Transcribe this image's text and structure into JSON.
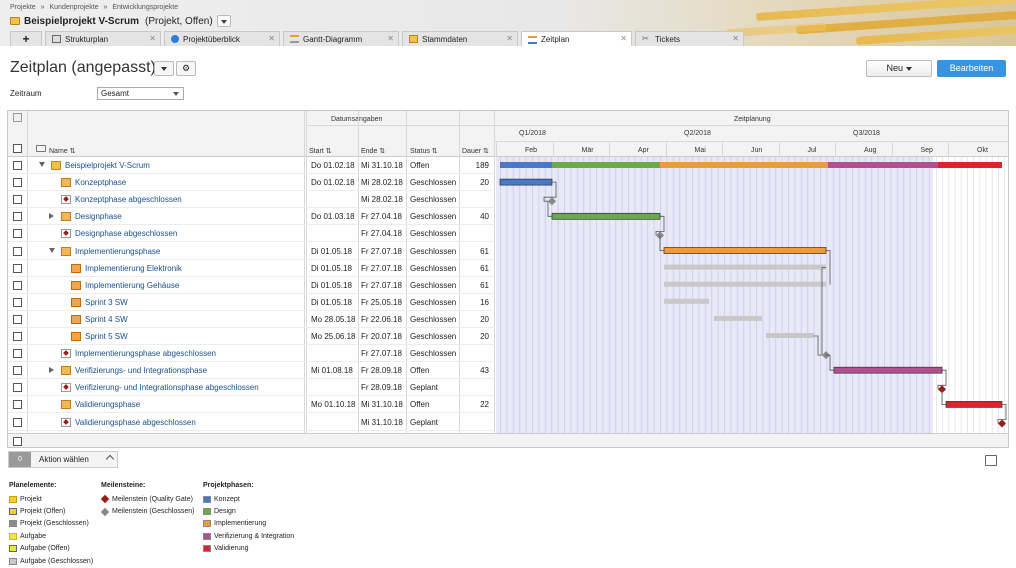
{
  "breadcrumb": [
    "Projekte",
    "»",
    "Kundenprojekte",
    "»",
    "Entwicklungsprojekte"
  ],
  "project": {
    "title": "Beispielprojekt V-Scrum",
    "subtitle": "(Projekt, Offen)"
  },
  "tabs": [
    {
      "label": "Strukturplan"
    },
    {
      "label": "Projektüberblick"
    },
    {
      "label": "Gantt-Diagramm"
    },
    {
      "label": "Stammdaten"
    },
    {
      "label": "Zeitplan"
    },
    {
      "label": "Tickets"
    }
  ],
  "plus": "+",
  "page": {
    "title": "Zeitplan (angepasst)",
    "btn_new": "Neu",
    "btn_edit": "Bearbeiten"
  },
  "filter": {
    "label": "Zeitraum",
    "value": "Gesamt"
  },
  "grid": {
    "group_dates": "Datumsangaben",
    "group_plan": "Zeitplanung",
    "col_name": "Name",
    "col_start": "Start",
    "col_end": "Ende",
    "col_status": "Status",
    "col_duration": "Dauer",
    "quarters": [
      "Q1/2018",
      "Q2/2018",
      "Q3/2018"
    ],
    "months": [
      "Feb",
      "Mär",
      "Apr",
      "Mai",
      "Jun",
      "Jul",
      "Aug",
      "Sep",
      "Okt"
    ],
    "rows": [
      {
        "name": "Beispielprojekt V-Scrum",
        "start": "Do 01.02.18",
        "end": "Mi 31.10.18",
        "status": "Offen",
        "dur": "189"
      },
      {
        "name": "Konzeptphase",
        "start": "Do 01.02.18",
        "end": "Mi 28.02.18",
        "status": "Geschlossen",
        "dur": "20"
      },
      {
        "name": "Konzeptphase abgeschlossen",
        "start": "",
        "end": "Mi 28.02.18",
        "status": "Geschlossen",
        "dur": ""
      },
      {
        "name": "Designphase",
        "start": "Do 01.03.18",
        "end": "Fr 27.04.18",
        "status": "Geschlossen",
        "dur": "40"
      },
      {
        "name": "Designphase abgeschlossen",
        "start": "",
        "end": "Fr 27.04.18",
        "status": "Geschlossen",
        "dur": ""
      },
      {
        "name": "Implementierungsphase",
        "start": "Di 01.05.18",
        "end": "Fr 27.07.18",
        "status": "Geschlossen",
        "dur": "61"
      },
      {
        "name": "Implementierung Elektronik",
        "start": "Di 01.05.18",
        "end": "Fr 27.07.18",
        "status": "Geschlossen",
        "dur": "61"
      },
      {
        "name": "Implementierung Gehäuse",
        "start": "Di 01.05.18",
        "end": "Fr 27.07.18",
        "status": "Geschlossen",
        "dur": "61"
      },
      {
        "name": "Sprint 3 SW",
        "start": "Di 01.05.18",
        "end": "Fr 25.05.18",
        "status": "Geschlossen",
        "dur": "16"
      },
      {
        "name": "Sprint 4 SW",
        "start": "Mo 28.05.18",
        "end": "Fr 22.06.18",
        "status": "Geschlossen",
        "dur": "20"
      },
      {
        "name": "Sprint 5 SW",
        "start": "Mo 25.06.18",
        "end": "Fr 20.07.18",
        "status": "Geschlossen",
        "dur": "20"
      },
      {
        "name": "Implementierungsphase abgeschlossen",
        "start": "",
        "end": "Fr 27.07.18",
        "status": "Geschlossen",
        "dur": ""
      },
      {
        "name": "Verifizierungs- und Integrationsphase",
        "start": "Mi 01.08.18",
        "end": "Fr 28.09.18",
        "status": "Offen",
        "dur": "43"
      },
      {
        "name": "Verifizierung- und Integrationsphase abgeschlossen",
        "start": "",
        "end": "Fr 28.09.18",
        "status": "Geplant",
        "dur": ""
      },
      {
        "name": "Validierungsphase",
        "start": "Mo 01.10.18",
        "end": "Mi 31.10.18",
        "status": "Offen",
        "dur": "22"
      },
      {
        "name": "Validierungsphase abgeschlossen",
        "start": "",
        "end": "Mi 31.10.18",
        "status": "Geplant",
        "dur": ""
      }
    ]
  },
  "footer": {
    "count": "0",
    "action": "Aktion wählen"
  },
  "legend": {
    "planelemente": {
      "title": "Planelemente:",
      "items": [
        "Projekt",
        "Projekt (Offen)",
        "Projekt (Geschlossen)",
        "Aufgabe",
        "Aufgabe (Offen)",
        "Aufgabe (Geschlossen)"
      ]
    },
    "meilensteine": {
      "title": "Meilensteine:",
      "items": [
        "Meilenstein (Quality Gate)",
        "Meilenstein (Geschlossen)"
      ]
    },
    "projektphasen": {
      "title": "Projektphasen:",
      "items": [
        "Konzept",
        "Design",
        "Implementierung",
        "Verifizierung & Integration",
        "Validierung"
      ]
    }
  },
  "colors": {
    "konzept": "#4a78c8",
    "design": "#6aaa48",
    "impl": "#f09a3a",
    "verif": "#b0508c",
    "valid": "#d8262a",
    "closed": "#c8c8c8",
    "milestone": "#9b1b1b",
    "ms_closed": "#888888"
  }
}
